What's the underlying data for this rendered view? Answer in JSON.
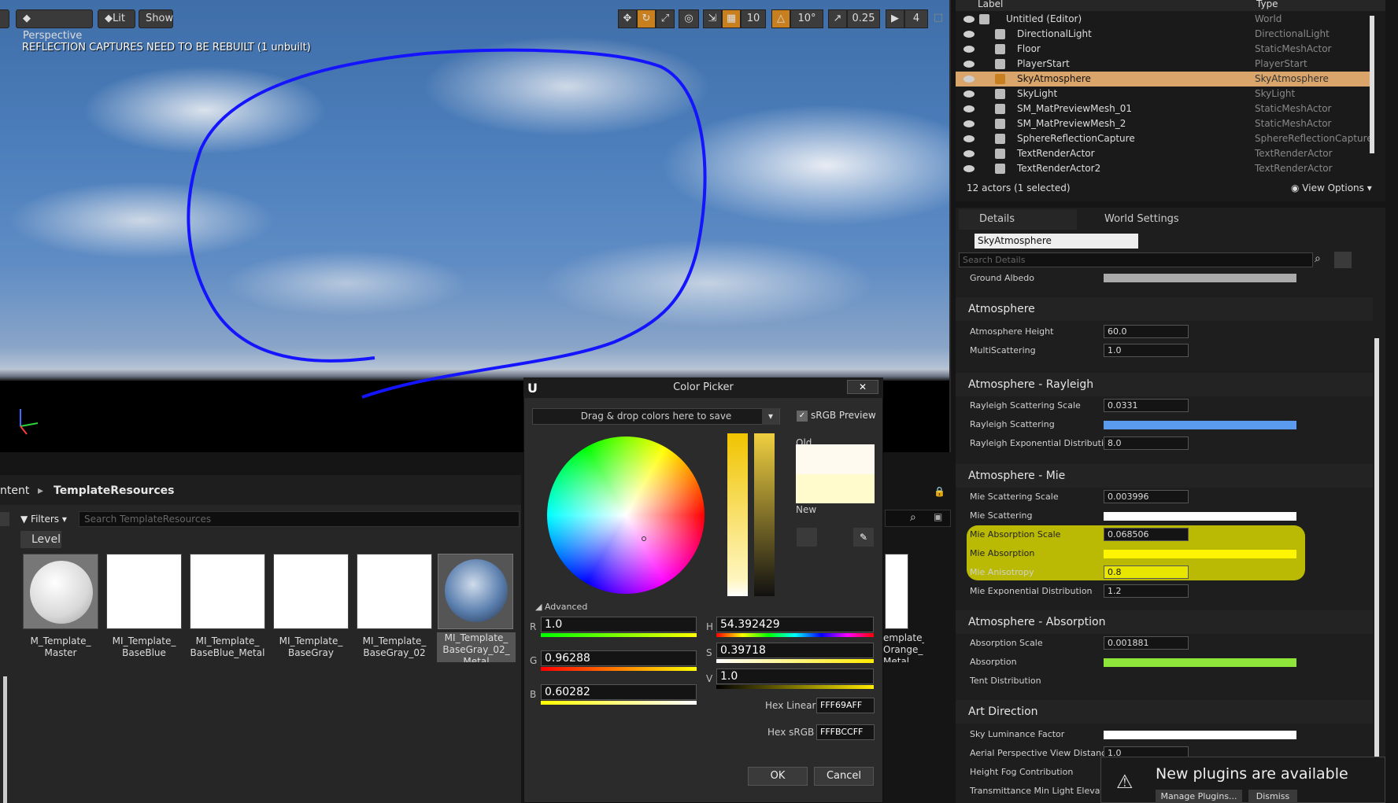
{
  "viewport": {
    "perspective": "Perspective",
    "lit": "Lit",
    "show": "Show",
    "grid_snap": "10",
    "rot_snap": "10°",
    "scale_snap": "0.25",
    "cam_speed": "4",
    "warning": "REFLECTION CAPTURES NEED TO BE REBUILT (1 unbuilt)"
  },
  "content_browser": {
    "crumbs": [
      "ntent",
      "TemplateResources"
    ],
    "filters": "Filters",
    "search_placeholder": "Search TemplateResources",
    "level": "Level",
    "assets": [
      "M_Template_ Master",
      "MI_Template_ BaseBlue",
      "MI_Template_ BaseBlue_Metal",
      "MI_Template_ BaseGray",
      "MI_Template_ BaseGray_02",
      "MI_Template_ BaseGray_02_ Metal",
      "emplate_ Orange_ Metal"
    ]
  },
  "outliner": {
    "col_label": "Label",
    "col_type": "Type",
    "rows": [
      {
        "label": "Untitled (Editor)",
        "type": "World"
      },
      {
        "label": "DirectionalLight",
        "type": "DirectionalLight"
      },
      {
        "label": "Floor",
        "type": "StaticMeshActor"
      },
      {
        "label": "PlayerStart",
        "type": "PlayerStart"
      },
      {
        "label": "SkyAtmosphere",
        "type": "SkyAtmosphere"
      },
      {
        "label": "SkyLight",
        "type": "SkyLight"
      },
      {
        "label": "SM_MatPreviewMesh_01",
        "type": "StaticMeshActor"
      },
      {
        "label": "SM_MatPreviewMesh_2",
        "type": "StaticMeshActor"
      },
      {
        "label": "SphereReflectionCapture",
        "type": "SphereReflectionCapture"
      },
      {
        "label": "TextRenderActor",
        "type": "TextRenderActor"
      },
      {
        "label": "TextRenderActor2",
        "type": "TextRenderActor"
      }
    ],
    "count": "12 actors (1 selected)",
    "view_options": "View Options"
  },
  "details": {
    "tab_details": "Details",
    "tab_world": "World Settings",
    "actor_name": "SkyAtmosphere",
    "search_placeholder": "Search Details",
    "ground_albedo": "Ground Albedo",
    "sections": {
      "atm": "Atmosphere",
      "ray": "Atmosphere - Rayleigh",
      "mie": "Atmosphere - Mie",
      "abs": "Atmosphere - Absorption",
      "art": "Art Direction"
    },
    "props": {
      "atm_height": "Atmosphere Height",
      "atm_height_v": "60.0",
      "multi": "MultiScattering",
      "multi_v": "1.0",
      "ray_scale": "Rayleigh Scattering Scale",
      "ray_scale_v": "0.0331",
      "ray_scat": "Rayleigh Scattering",
      "ray_exp": "Rayleigh Exponential Distribution",
      "ray_exp_v": "8.0",
      "mie_scale": "Mie Scattering Scale",
      "mie_scale_v": "0.003996",
      "mie_scat": "Mie Scattering",
      "mie_abs_scale": "Mie Absorption Scale",
      "mie_abs_scale_v": "0.068506",
      "mie_abs": "Mie Absorption",
      "mie_aniso": "Mie Anisotropy",
      "mie_aniso_v": "0.8",
      "mie_exp": "Mie Exponential Distribution",
      "mie_exp_v": "1.2",
      "abs_scale": "Absorption Scale",
      "abs_scale_v": "0.001881",
      "abs": "Absorption",
      "tent": "Tent Distribution",
      "sky_lum": "Sky Luminance Factor",
      "aerial": "Aerial Perspective View Distance Sc",
      "aerial_v": "1.0",
      "fog": "Height Fog Contribution",
      "trans": "Transmittance Min Light Elevation"
    }
  },
  "picker": {
    "title": "Color Picker",
    "drop": "Drag & drop colors here to save",
    "srgb": "sRGB Preview",
    "old": "Old",
    "new": "New",
    "advanced": "Advanced",
    "r": "1.0",
    "g": "0.96288",
    "b": "0.60282",
    "h": "54.392429",
    "s": "0.39718",
    "v": "1.0",
    "hex_linear_label": "Hex Linear",
    "hex_linear": "FFF69AFF",
    "hex_srgb_label": "Hex sRGB",
    "hex_srgb": "FFFBCCFF",
    "ok": "OK",
    "cancel": "Cancel"
  },
  "notification": {
    "text": "New plugins are available",
    "manage": "Manage Plugins...",
    "dismiss": "Dismiss"
  }
}
